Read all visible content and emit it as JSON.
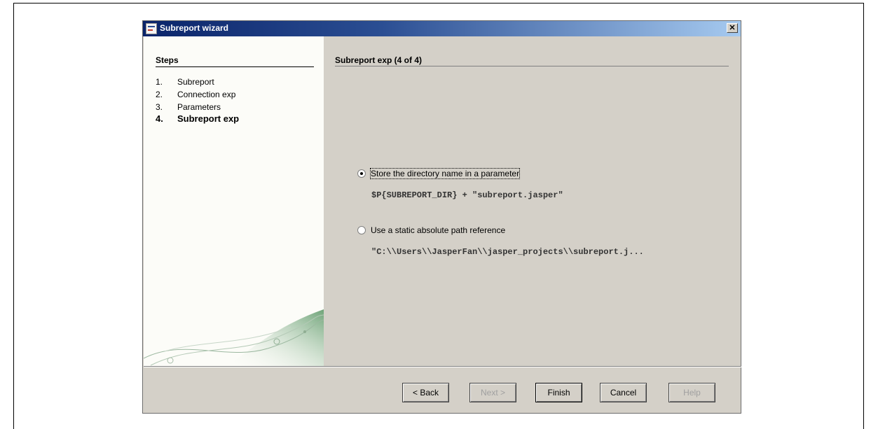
{
  "window": {
    "title": "Subreport wizard",
    "close_label": "✕"
  },
  "steps": {
    "title": "Steps",
    "items": [
      {
        "num": "1.",
        "label": "Subreport"
      },
      {
        "num": "2.",
        "label": "Connection exp"
      },
      {
        "num": "3.",
        "label": "Parameters"
      },
      {
        "num": "4.",
        "label": "Subreport exp"
      }
    ],
    "active_index": 3
  },
  "main": {
    "title": "Subreport exp (4 of 4)",
    "options": [
      {
        "label": "Store the directory name in a parameter",
        "expression": "$P{SUBREPORT_DIR} + \"subreport.jasper\"",
        "selected": true
      },
      {
        "label": "Use a static absolute path reference",
        "expression": "\"C:\\\\Users\\\\JasperFan\\\\jasper_projects\\\\subreport.j...",
        "selected": false
      }
    ]
  },
  "buttons": {
    "back": "< Back",
    "next": "Next >",
    "finish": "Finish",
    "cancel": "Cancel",
    "help": "Help"
  }
}
